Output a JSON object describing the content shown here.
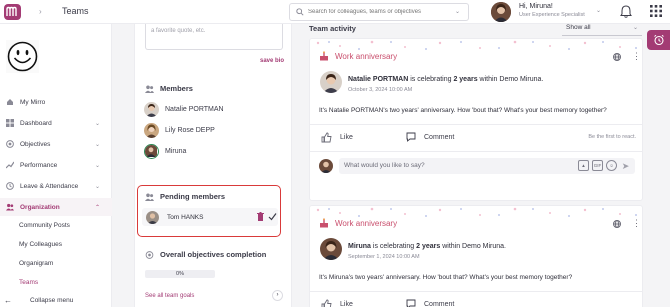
{
  "header": {
    "title": "Teams",
    "search_placeholder": "Search for colleagues, teams or objectives",
    "user_greeting": "Hi, Miruna!",
    "user_role": "User Experience Specialist",
    "brand_color": "#a33b74"
  },
  "sidebar": {
    "items": [
      {
        "label": "My Mirro",
        "icon": "home-icon"
      },
      {
        "label": "Dashboard",
        "icon": "dashboard-icon"
      },
      {
        "label": "Objectives",
        "icon": "target-icon"
      },
      {
        "label": "Performance",
        "icon": "trend-icon"
      },
      {
        "label": "Leave & Attendance",
        "icon": "clock-icon"
      },
      {
        "label": "Organization",
        "icon": "people-icon"
      }
    ],
    "subitems": [
      "Community Posts",
      "My Colleagues",
      "Organigram",
      "Teams"
    ],
    "collapse_label": "Collapse menu"
  },
  "team_panel": {
    "quote_placeholder": "a favorite quote, etc.",
    "save_bio": "save bio",
    "members_title": "Members",
    "members": [
      "Natalie PORTMAN",
      "Lily Rose DEPP",
      "Miruna"
    ],
    "pending_title": "Pending members",
    "pending_member": "Tom HANKS",
    "objectives_title": "Overall objectives completion",
    "objectives_progress": "0%",
    "see_all_goals": "See all team goals"
  },
  "feed": {
    "title": "Team activity",
    "filter": "Show all",
    "posts": [
      {
        "type_label": "Work anniversary",
        "name": "Natalie PORTMAN",
        "celebrating": "is celebrating",
        "years": "2 years",
        "within": "within Demo Miruna.",
        "date": "October 3, 2024 10:00 AM",
        "body": "It's Natalie PORTMAN's two years' anniversary. How 'bout that? What's your best memory together?"
      },
      {
        "type_label": "Work anniversary",
        "name": "Miruna",
        "celebrating": "is celebrating",
        "years": "2 years",
        "within": "within Demo Miruna.",
        "date": "September 1, 2024 10:00 AM",
        "body": "It's Miruna's two years' anniversary. How 'bout that? What's your best memory together?"
      }
    ],
    "like_label": "Like",
    "comment_label": "Comment",
    "first_react": "Be the first to react.",
    "comment_placeholder": "What would you like to say?",
    "gif_label": "GIF"
  }
}
